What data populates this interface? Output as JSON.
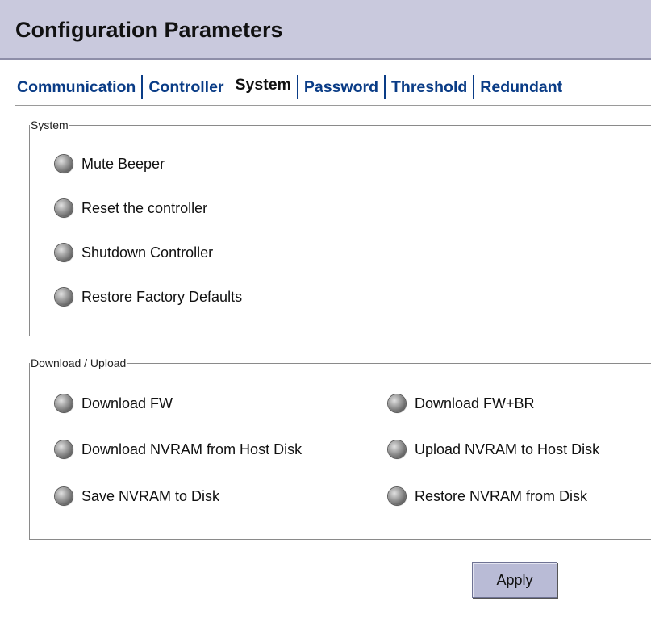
{
  "header": {
    "title": "Configuration Parameters"
  },
  "tabs": [
    {
      "label": "Communication",
      "active": false
    },
    {
      "label": "Controller",
      "active": false
    },
    {
      "label": "System",
      "active": true
    },
    {
      "label": "Password",
      "active": false
    },
    {
      "label": "Threshold",
      "active": false
    },
    {
      "label": "Redundant",
      "active": false
    }
  ],
  "system_group": {
    "legend": "System",
    "options": [
      {
        "label": "Mute Beeper"
      },
      {
        "label": "Reset the controller"
      },
      {
        "label": "Shutdown Controller"
      },
      {
        "label": "Restore Factory Defaults"
      }
    ]
  },
  "download_group": {
    "legend": "Download / Upload",
    "options": [
      {
        "label": "Download FW"
      },
      {
        "label": "Download FW+BR"
      },
      {
        "label": "Download NVRAM from Host Disk"
      },
      {
        "label": "Upload NVRAM to Host Disk"
      },
      {
        "label": "Save NVRAM to Disk"
      },
      {
        "label": "Restore NVRAM from Disk"
      }
    ]
  },
  "apply_button": {
    "label": "Apply"
  },
  "colors": {
    "header_bg": "#c9c9dd",
    "tab_text": "#0a3c86",
    "button_bg": "#b9bbd6"
  },
  "icons": {
    "radio": "radio-button-icon"
  }
}
